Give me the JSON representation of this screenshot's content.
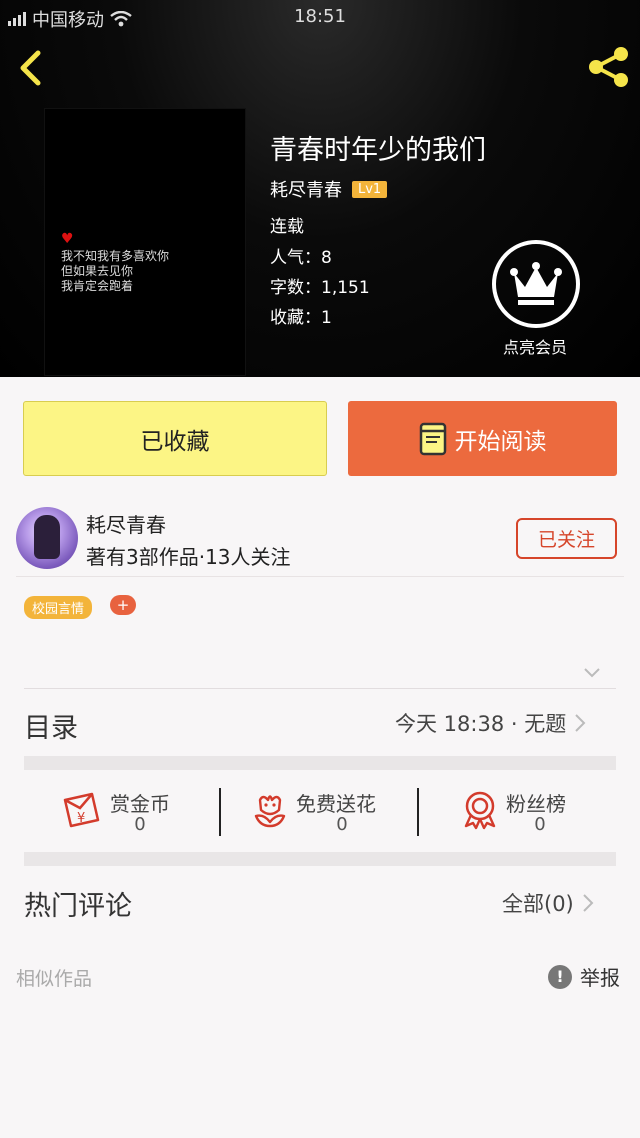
{
  "status_bar": {
    "carrier": "中国移动",
    "time": "18:51"
  },
  "book": {
    "title": "青春时年少的我们",
    "author": "耗尽青春",
    "level": "Lv1",
    "status": "连载",
    "popularity": "人气：8",
    "word_count": "字数：1,151",
    "favorites": "收藏：1",
    "cover_text": "我不知我有多喜欢你\n但如果去见你\n我肯定会跑着"
  },
  "vip": {
    "label": "点亮会员"
  },
  "actions": {
    "favorited_label": "已收藏",
    "read_label": "开始阅读"
  },
  "author_info": {
    "name": "耗尽青春",
    "stats": "著有3部作品·13人关注",
    "follow_label": "已关注"
  },
  "tags": {
    "items": [
      "校园言情"
    ],
    "add_label": "+"
  },
  "toc": {
    "title": "目录",
    "latest": "今天 18:38 · 无题"
  },
  "stats": {
    "reward": {
      "label": "赏金币",
      "value": "0"
    },
    "flowers": {
      "label": "免费送花",
      "value": "0"
    },
    "fans": {
      "label": "粉丝榜",
      "value": "0"
    }
  },
  "comments": {
    "title": "热门评论",
    "all_label": "全部(0)"
  },
  "similar": {
    "label": "相似作品"
  },
  "report": {
    "label": "举报",
    "icon": "!"
  },
  "colors": {
    "accent_orange": "#ec6a3e",
    "accent_yellow": "#fcf585",
    "follow_red": "#d6452a",
    "icon_red": "#d33b2c",
    "badge": "#f3b43a"
  }
}
